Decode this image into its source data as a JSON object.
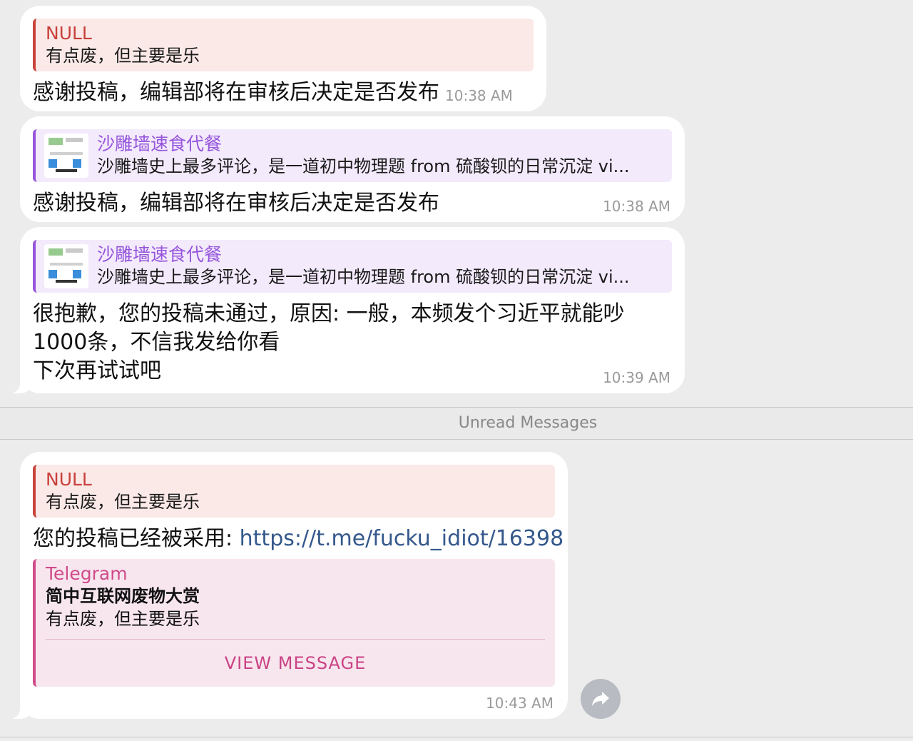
{
  "messages": [
    {
      "reply_name": "NULL",
      "reply_text": "有点废，但主要是乐",
      "text": "感谢投稿，编辑部将在审核后决定是否发布",
      "time": "10:38 AM"
    },
    {
      "reply_name": "沙雕墙速食代餐",
      "reply_text": "沙雕墙史上最多评论，是一道初中物理题 from 硫酸钡的日常沉淀 vi...",
      "text": "感谢投稿，编辑部将在审核后决定是否发布",
      "time": "10:38 AM"
    },
    {
      "reply_name": "沙雕墙速食代餐",
      "reply_text": "沙雕墙史上最多评论，是一道初中物理题 from 硫酸钡的日常沉淀 vi...",
      "text_line1": "很抱歉，您的投稿未通过，原因: 一般，本频发个习近平就能吵",
      "text_line2": "1000条，不信我发给你看",
      "text_line3": "下次再试试吧",
      "time": "10:39 AM"
    },
    {
      "reply_name": "NULL",
      "reply_text": "有点废，但主要是乐",
      "text_prefix": "您的投稿已经被采用: ",
      "link": "https://t.me/fucku_idiot/16398",
      "preview_site": "Telegram",
      "preview_title": "简中互联网废物大赏",
      "preview_desc": "有点废，但主要是乐",
      "preview_button": "VIEW MESSAGE",
      "time": "10:43 AM"
    }
  ],
  "unread_label": "Unread Messages",
  "icons": {
    "share": "share-forward-icon"
  },
  "colors": {
    "background": "#ececec",
    "bubble": "#ffffff",
    "reply_red": "#c9433b",
    "reply_purple": "#9655d9",
    "preview_pink": "#d04b8a",
    "link": "#34588c"
  }
}
